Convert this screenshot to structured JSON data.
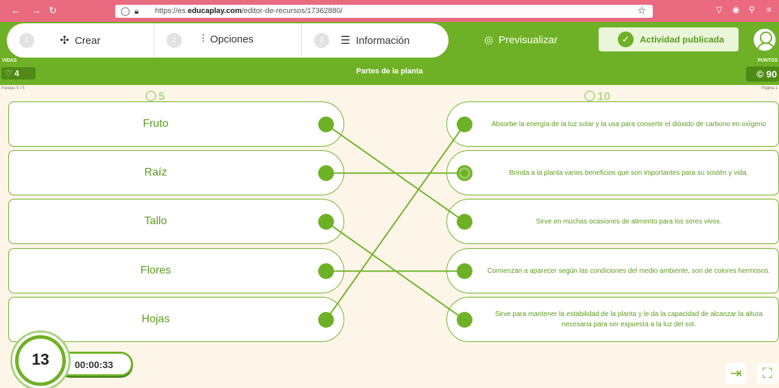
{
  "browser": {
    "back": "←",
    "forward": "→",
    "reload": "↻",
    "url_prefix": "https://es.",
    "url_domain": "educaplay.com",
    "url_path": "/editor-de-recursos/17362880/"
  },
  "steps": [
    {
      "num": "1",
      "label": "Crear"
    },
    {
      "num": "2",
      "label": "Opciones"
    },
    {
      "num": "3",
      "label": "Información"
    }
  ],
  "preview_label": "Previsualizar",
  "published_label": "Actividad publicada",
  "lives": {
    "label": "VIDAS",
    "value": "4"
  },
  "title": "Partes de la planta",
  "points": {
    "label": "PUNTOS",
    "value": "90"
  },
  "pairs_label": "Parejas 5 / 5",
  "page_label": "Página 1",
  "left_score": "5",
  "right_score": "10",
  "left_items": [
    "Fruto",
    "Raíz",
    "Tallo",
    "Flores",
    "Hojas"
  ],
  "right_items": [
    "Absorbe la energía de la luz solar y la usa para convertir el dióxido de carbono en oxígeno",
    "Brinda a la planta varios beneficios que son importantes para su sostén y vida.",
    "Sirve en muchas ocasiones de alimento para los seres vivos.",
    "Comienzan a aparecer según las condiciones del medio ambiente, son de colores hermosos.",
    "Sirve para mantener la estabilidad de la planta y le da la capacidad de alcanzar la altura necesaria para ser expuesta a la luz del sol."
  ],
  "connections": [
    {
      "from": 0,
      "to": 2
    },
    {
      "from": 1,
      "to": 1
    },
    {
      "from": 2,
      "to": 4
    },
    {
      "from": 3,
      "to": 3
    },
    {
      "from": 4,
      "to": 0
    }
  ],
  "timer": {
    "count": "13",
    "time": "00:00:33"
  },
  "colors": {
    "accent": "#6fb126",
    "browser_bar": "#ea6b80"
  }
}
